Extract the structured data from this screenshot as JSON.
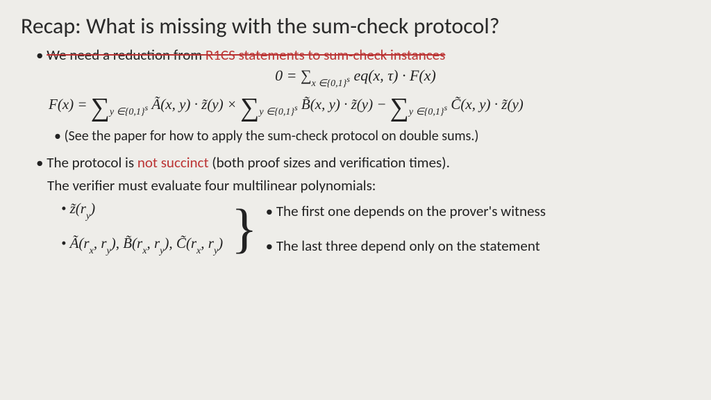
{
  "title": "Recap: What is missing with the sum-check protocol?",
  "line1_a": "We need a reduction from ",
  "line1_b": "R1CS statements to sum-check instances",
  "eq1": "0 = ∑",
  "eq1_sub": "x ∈{0,1}",
  "eq1_sup": "s",
  "eq1_body": " eq(x, τ) · F(x)",
  "eq2_lhs": "F(x) = ",
  "eq2_sum": "∑",
  "eq2_sub": "y ∈{0,1}",
  "eq2_sup": "s",
  "eq2_a": "Ã(x, y) · z̃(y) × ",
  "eq2_b": "B̃(x, y) · z̃(y) − ",
  "eq2_c": "C̃(x, y) · z̃(y)",
  "note": "(See the paper for how to apply the sum-check protocol on double sums.)",
  "line3_a": "The protocol is ",
  "line3_b": "not succinct",
  "line3_c": " (both proof sizes and verification times).",
  "line4": "The verifier must evaluate four multilinear polynomials:",
  "poly1": "z̃(r",
  "poly1_sub": "y",
  "poly1_end": ")",
  "poly2": "Ã(r",
  "poly2_x": "x",
  "poly2_m": ", r",
  "poly2_y": "y",
  "poly2_e": "),  B̃(r",
  "poly2_e2": "), C̃(r",
  "poly2_end": ")",
  "right1": "The first one depends on the prover's witness",
  "right2": "The last three depend only on the statement"
}
